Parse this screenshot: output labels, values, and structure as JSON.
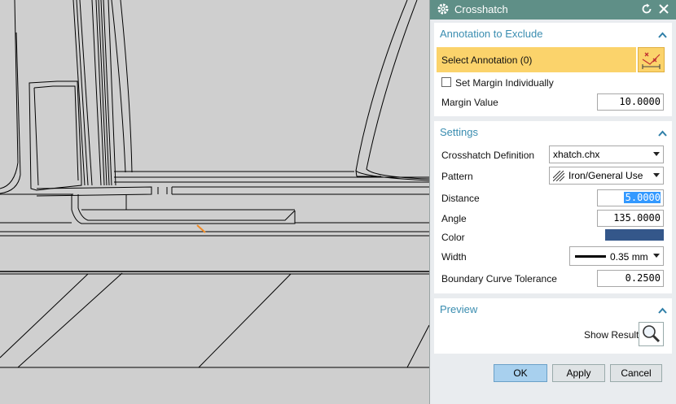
{
  "dialog": {
    "title": "Crosshatch",
    "groups": {
      "annotation": {
        "title": "Annotation to Exclude",
        "select_label": "Select Annotation (0)",
        "set_margin_label": "Set Margin Individually",
        "set_margin_checked": false,
        "margin_value_label": "Margin Value",
        "margin_value": "10.0000"
      },
      "settings": {
        "title": "Settings",
        "definition_label": "Crosshatch Definition",
        "definition_value": "xhatch.chx",
        "pattern_label": "Pattern",
        "pattern_value": "Iron/General Use",
        "distance_label": "Distance",
        "distance_value": "5.0000",
        "angle_label": "Angle",
        "angle_value": "135.0000",
        "color_label": "Color",
        "color_value": "#34578a",
        "width_label": "Width",
        "width_value": "0.35 mm",
        "tolerance_label": "Boundary Curve Tolerance",
        "tolerance_value": "0.2500"
      },
      "preview": {
        "title": "Preview",
        "show_result_label": "Show Result"
      }
    },
    "buttons": {
      "ok": "OK",
      "apply": "Apply",
      "cancel": "Cancel"
    },
    "colors": {
      "titlebar": "#5f8f87",
      "accent_text": "#3a8db0",
      "select_highlight": "#fbd36b",
      "selected_field": "#3399ff",
      "ok_button": "#a8d0ee"
    }
  }
}
